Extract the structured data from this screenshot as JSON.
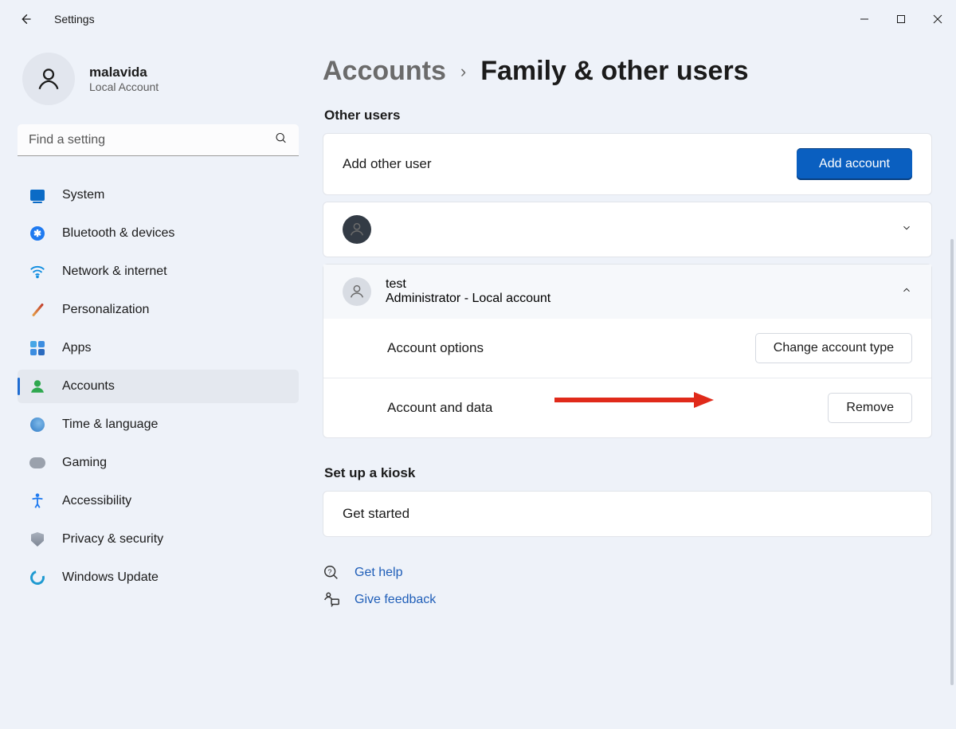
{
  "app": {
    "title": "Settings"
  },
  "profile": {
    "name": "malavida",
    "sub": "Local Account"
  },
  "search": {
    "placeholder": "Find a setting"
  },
  "nav": [
    {
      "label": "System"
    },
    {
      "label": "Bluetooth & devices"
    },
    {
      "label": "Network & internet"
    },
    {
      "label": "Personalization"
    },
    {
      "label": "Apps"
    },
    {
      "label": "Accounts"
    },
    {
      "label": "Time & language"
    },
    {
      "label": "Gaming"
    },
    {
      "label": "Accessibility"
    },
    {
      "label": "Privacy & security"
    },
    {
      "label": "Windows Update"
    }
  ],
  "breadcrumb": {
    "parent": "Accounts",
    "sep": "›",
    "title": "Family & other users"
  },
  "section_other": "Other users",
  "addRow": {
    "label": "Add other user",
    "button": "Add account"
  },
  "userExpanded": {
    "name": "test",
    "sub": "Administrator - Local account",
    "opt1_label": "Account options",
    "opt1_btn": "Change account type",
    "opt2_label": "Account and data",
    "opt2_btn": "Remove"
  },
  "section_kiosk": "Set up a kiosk",
  "kiosk": {
    "label": "Get started"
  },
  "footer": {
    "help": "Get help",
    "feedback": "Give feedback"
  }
}
